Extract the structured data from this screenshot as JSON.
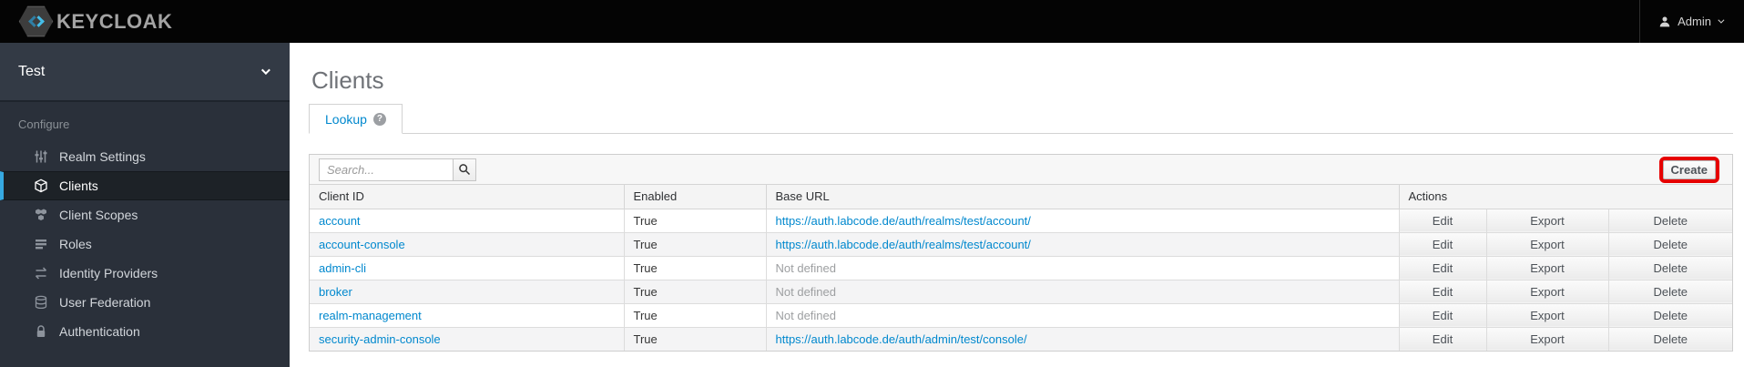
{
  "header": {
    "brand": "KEYCLOAK",
    "user_menu": {
      "label": "Admin",
      "icon": "user-icon"
    }
  },
  "sidebar": {
    "realm": {
      "name": "Test",
      "icon": "chevron-down-icon"
    },
    "section_label": "Configure",
    "items": [
      {
        "label": "Realm Settings",
        "icon": "sliders-icon",
        "active": false
      },
      {
        "label": "Clients",
        "icon": "cube-icon",
        "active": true
      },
      {
        "label": "Client Scopes",
        "icon": "cubes-icon",
        "active": false
      },
      {
        "label": "Roles",
        "icon": "list-icon",
        "active": false
      },
      {
        "label": "Identity Providers",
        "icon": "exchange-arrows-icon",
        "active": false
      },
      {
        "label": "User Federation",
        "icon": "database-icon",
        "active": false
      },
      {
        "label": "Authentication",
        "icon": "lock-icon",
        "active": false
      }
    ]
  },
  "main": {
    "title": "Clients",
    "tabs": [
      {
        "label": "Lookup",
        "active": true,
        "help_icon": "question-circle-icon",
        "help_glyph": "?"
      }
    ],
    "toolbar": {
      "search_placeholder": "Search...",
      "search_icon": "magnifier-icon",
      "create_label": "Create"
    },
    "table": {
      "columns": [
        "Client ID",
        "Enabled",
        "Base URL",
        "Actions"
      ],
      "action_labels": [
        "Edit",
        "Export",
        "Delete"
      ],
      "rows": [
        {
          "client_id": "account",
          "enabled": "True",
          "base_url": "https://auth.labcode.de/auth/realms/test/account/",
          "base_url_defined": true
        },
        {
          "client_id": "account-console",
          "enabled": "True",
          "base_url": "https://auth.labcode.de/auth/realms/test/account/",
          "base_url_defined": true
        },
        {
          "client_id": "admin-cli",
          "enabled": "True",
          "base_url": "Not defined",
          "base_url_defined": false
        },
        {
          "client_id": "broker",
          "enabled": "True",
          "base_url": "Not defined",
          "base_url_defined": false
        },
        {
          "client_id": "realm-management",
          "enabled": "True",
          "base_url": "Not defined",
          "base_url_defined": false
        },
        {
          "client_id": "security-admin-console",
          "enabled": "True",
          "base_url": "https://auth.labcode.de/auth/admin/test/console/",
          "base_url_defined": true
        }
      ]
    }
  },
  "colors": {
    "topbar_bg": "#040404",
    "sidebar_bg": "#2a303a",
    "active_item_accent": "#36a9e1",
    "link_blue": "#0088ce",
    "highlight_red": "#e60000"
  }
}
